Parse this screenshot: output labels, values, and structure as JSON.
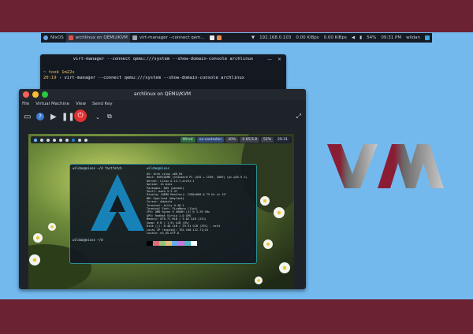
{
  "taskbar": {
    "workspace": "NixOS",
    "tasks": [
      "archlinux on QEMU/KVM",
      "virt-manager --connect qem..."
    ],
    "ip": "192.168.0.103",
    "net_down": "0.00 KiBps",
    "net_up": "0.00 KiBps",
    "battery": "54%",
    "time": "09:31 PM",
    "user": "wildan"
  },
  "terminal": {
    "title": "virt-manager --connect qemu:///system --show-domain-console archlinux",
    "line1": "~ took 1m22s",
    "line2_time": "20:19",
    "line2_cmd": "› virt-manager --connect qemu:///system --show-domain-console archlinux"
  },
  "vm_window": {
    "title": "archlinux on QEMU/KVM",
    "menu": [
      "File",
      "Virtual Machine",
      "View",
      "Send Key"
    ]
  },
  "guest": {
    "bar": {
      "wifi": "Wired",
      "controller": "no-controller",
      "vol": "40%",
      "mem": "0.85/3.8",
      "cpu": "52%",
      "clock": "20:31"
    },
    "fastfetch": {
      "caption_left": "wildan@nixos ~/d fastfetch",
      "caption_right": "wildan@nixos",
      "info": [
        "OS: Arch Linux x86_64",
        "Host: KVM/QEMU (Standard PC (Q35 + ICH9, 2009) (pc-q35-9.2)",
        "Kernel: Linux 6.13.7-arch1-1",
        "Uptime: 14 mins",
        "Packages: 885 (pacman)",
        "Shell: bash 5.2.37",
        "Display (QEMU Monitor): 1280x800 @ 75 Hz in 15\"",
        "WM: Hyprland (Wayland)",
        "Cursor: Adwaita",
        "Terminal: kitty 0.40.1",
        "Terminal Font: FiraMono (11pt)",
        "CPU: AMD Ryzen 5 5600H (4) @ 3.29 GHz",
        "GPU: RedHat Virtio 1.0 GPU",
        "Memory: 870.71 MiB / 3.82 GiB (22%)",
        "Swap: 0 B / 1.91 GiB (0%)",
        "Disk (/): 8.48 GiB / 29.51 GiB (29%) - ext4",
        "Local IP (enp1s0): 192.168.122.71/24",
        "Locale: en_US.UTF-8"
      ],
      "prompt": "wildan@nixos ~/d"
    }
  },
  "logo": {
    "text": "VM"
  },
  "colors": {
    "band": "#6b2233",
    "desktop": "#73b9ee",
    "teal": "#2f8f90",
    "red_btn": "#e0312f"
  }
}
